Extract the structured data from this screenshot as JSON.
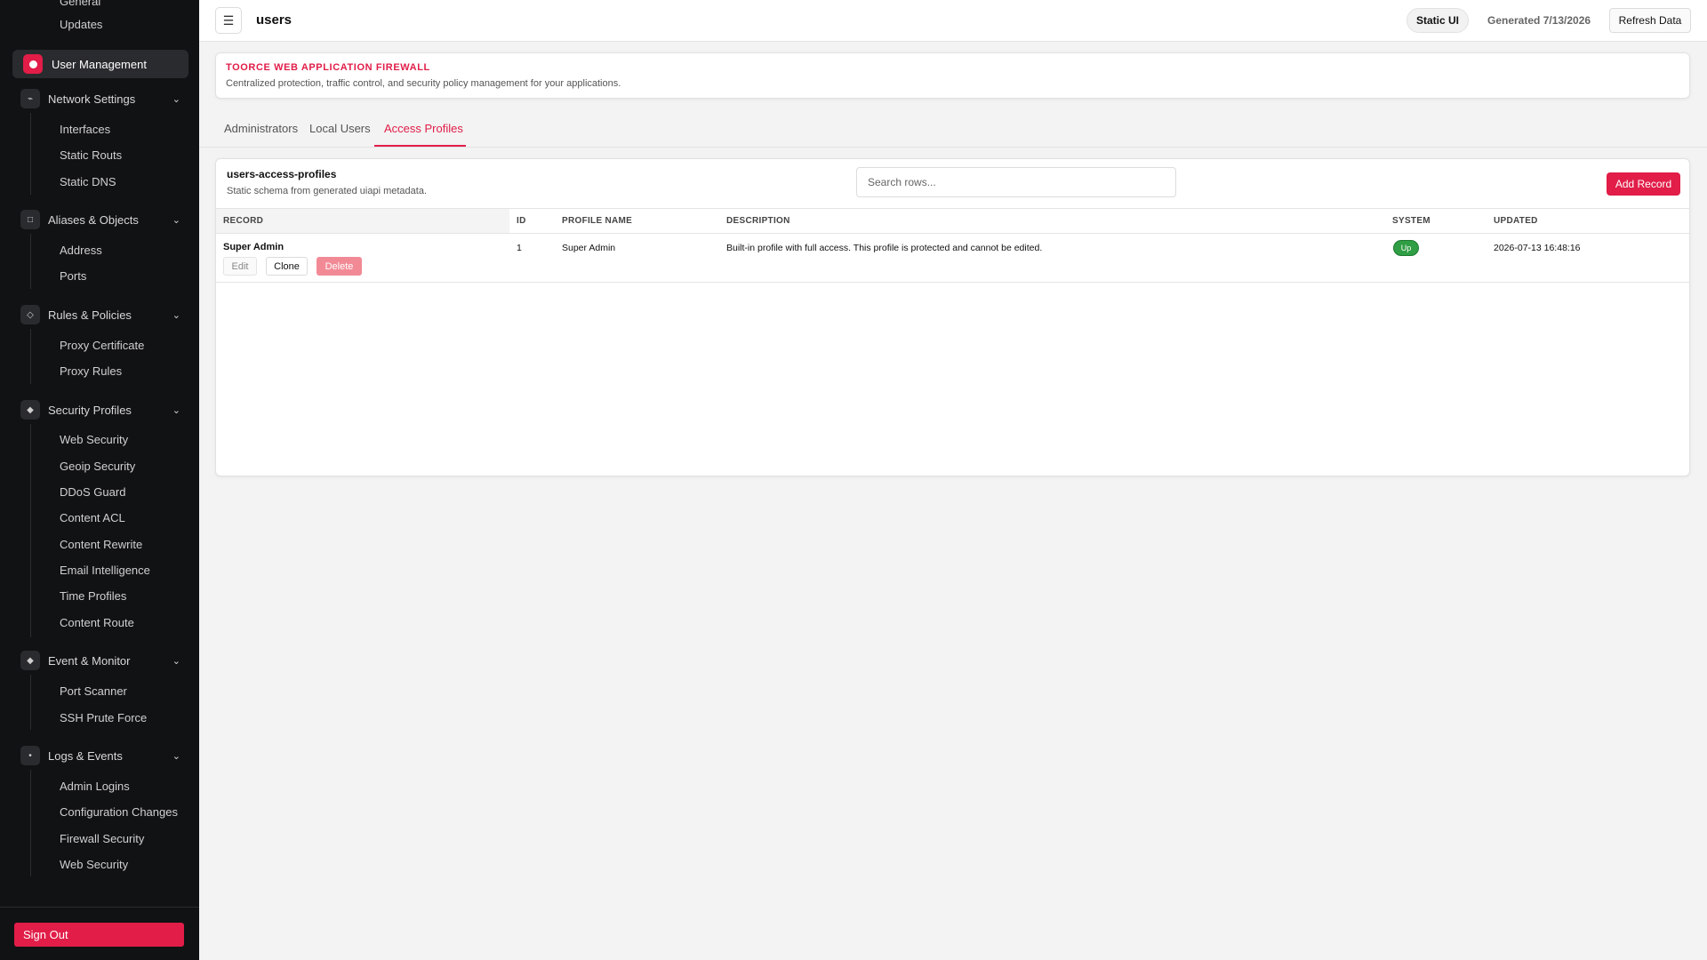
{
  "sidebar": {
    "items_above": [
      "General",
      "Updates"
    ],
    "active": "User Management",
    "groups": [
      {
        "label": "Network Settings",
        "icon": "network-icon",
        "items": [
          "Interfaces",
          "Static Routs",
          "Static DNS"
        ]
      },
      {
        "label": "Aliases & Objects",
        "icon": "square-icon",
        "items": [
          "Address",
          "Ports"
        ]
      },
      {
        "label": "Rules & Policies",
        "icon": "diamond-outline-icon",
        "items": [
          "Proxy Certificate",
          "Proxy Rules"
        ]
      },
      {
        "label": "Security Profiles",
        "icon": "diamond-icon",
        "items": [
          "Web Security",
          "Geoip Security",
          "DDoS Guard",
          "Content ACL",
          "Content Rewrite",
          "Email Intelligence",
          "Time Profiles",
          "Content Route"
        ]
      },
      {
        "label": "Event & Monitor",
        "icon": "diamond-icon",
        "items": [
          "Port Scanner",
          "SSH Prute Force"
        ]
      },
      {
        "label": "Logs & Events",
        "icon": "dot-icon",
        "items": [
          "Admin Logins",
          "Configuration Changes",
          "Firewall Security",
          "Web Security"
        ]
      }
    ],
    "sign_out": "Sign Out"
  },
  "topbar": {
    "menu_glyph": "☰",
    "title": "users",
    "static_ui": "Static UI",
    "generated": "Generated 7/13/2026",
    "refresh": "Refresh Data"
  },
  "banner": {
    "title": "TOORCE WEB APPLICATION FIREWALL",
    "subtitle": "Centralized protection, traffic control, and security policy management for your applications."
  },
  "tabs": [
    "Administrators",
    "Local Users",
    "Access Profiles"
  ],
  "active_tab": "Access Profiles",
  "panel": {
    "title": "users-access-profiles",
    "subtitle": "Static schema from generated uiapi metadata.",
    "search_placeholder": "Search rows...",
    "add_button": "Add Record",
    "columns": [
      "RECORD",
      "ID",
      "PROFILE NAME",
      "DESCRIPTION",
      "SYSTEM",
      "UPDATED"
    ],
    "rows": [
      {
        "record": "Super Admin",
        "actions": [
          "Edit",
          "Clone",
          "Delete"
        ],
        "id": "1",
        "profile_name": "Super Admin",
        "description": "Built-in profile with full access. This profile is protected and cannot be edited.",
        "system": "Up",
        "updated": "2026-07-13 16:48:16"
      }
    ]
  },
  "colors": {
    "accent": "#e11d48",
    "sidebar_bg": "#111214",
    "status_up": "#2f9e44"
  }
}
